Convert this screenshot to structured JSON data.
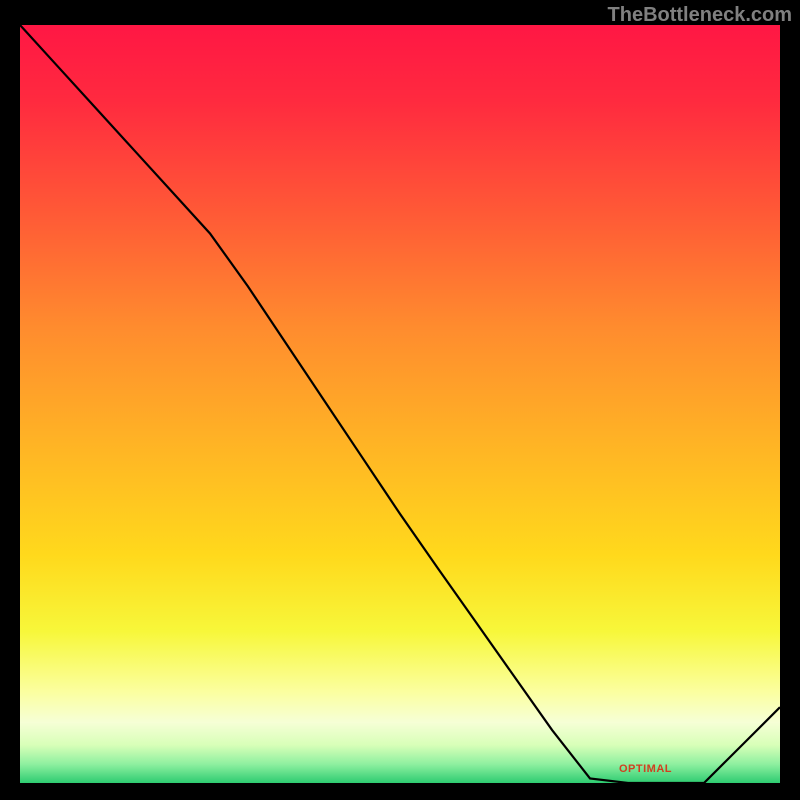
{
  "watermark": "TheBottleneck.com",
  "optimal_label": "OPTIMAL",
  "chart_data": {
    "type": "line",
    "title": "",
    "xlabel": "",
    "ylabel": "",
    "x": [
      0.0,
      0.05,
      0.1,
      0.15,
      0.2,
      0.25,
      0.3,
      0.35,
      0.4,
      0.45,
      0.5,
      0.55,
      0.6,
      0.65,
      0.7,
      0.75,
      0.8,
      0.85,
      0.9,
      0.95,
      1.0
    ],
    "values": [
      1.0,
      0.945,
      0.89,
      0.835,
      0.78,
      0.725,
      0.655,
      0.58,
      0.505,
      0.43,
      0.355,
      0.283,
      0.212,
      0.141,
      0.07,
      0.006,
      0.0,
      0.0,
      0.0,
      0.05,
      0.1
    ],
    "ylim": [
      0,
      1
    ],
    "xlim": [
      0,
      1
    ],
    "optimal_range_x": [
      0.75,
      0.9
    ],
    "gradient_stops": [
      {
        "offset": 0.0,
        "color": "#ff1744"
      },
      {
        "offset": 0.1,
        "color": "#ff2a3f"
      },
      {
        "offset": 0.25,
        "color": "#ff5a36"
      },
      {
        "offset": 0.4,
        "color": "#ff8c2e"
      },
      {
        "offset": 0.55,
        "color": "#ffb325"
      },
      {
        "offset": 0.7,
        "color": "#ffd91c"
      },
      {
        "offset": 0.8,
        "color": "#f7f73a"
      },
      {
        "offset": 0.88,
        "color": "#fbffa0"
      },
      {
        "offset": 0.92,
        "color": "#f6ffd6"
      },
      {
        "offset": 0.95,
        "color": "#d8ffb8"
      },
      {
        "offset": 0.975,
        "color": "#8ff0a0"
      },
      {
        "offset": 1.0,
        "color": "#2ecc71"
      }
    ]
  }
}
